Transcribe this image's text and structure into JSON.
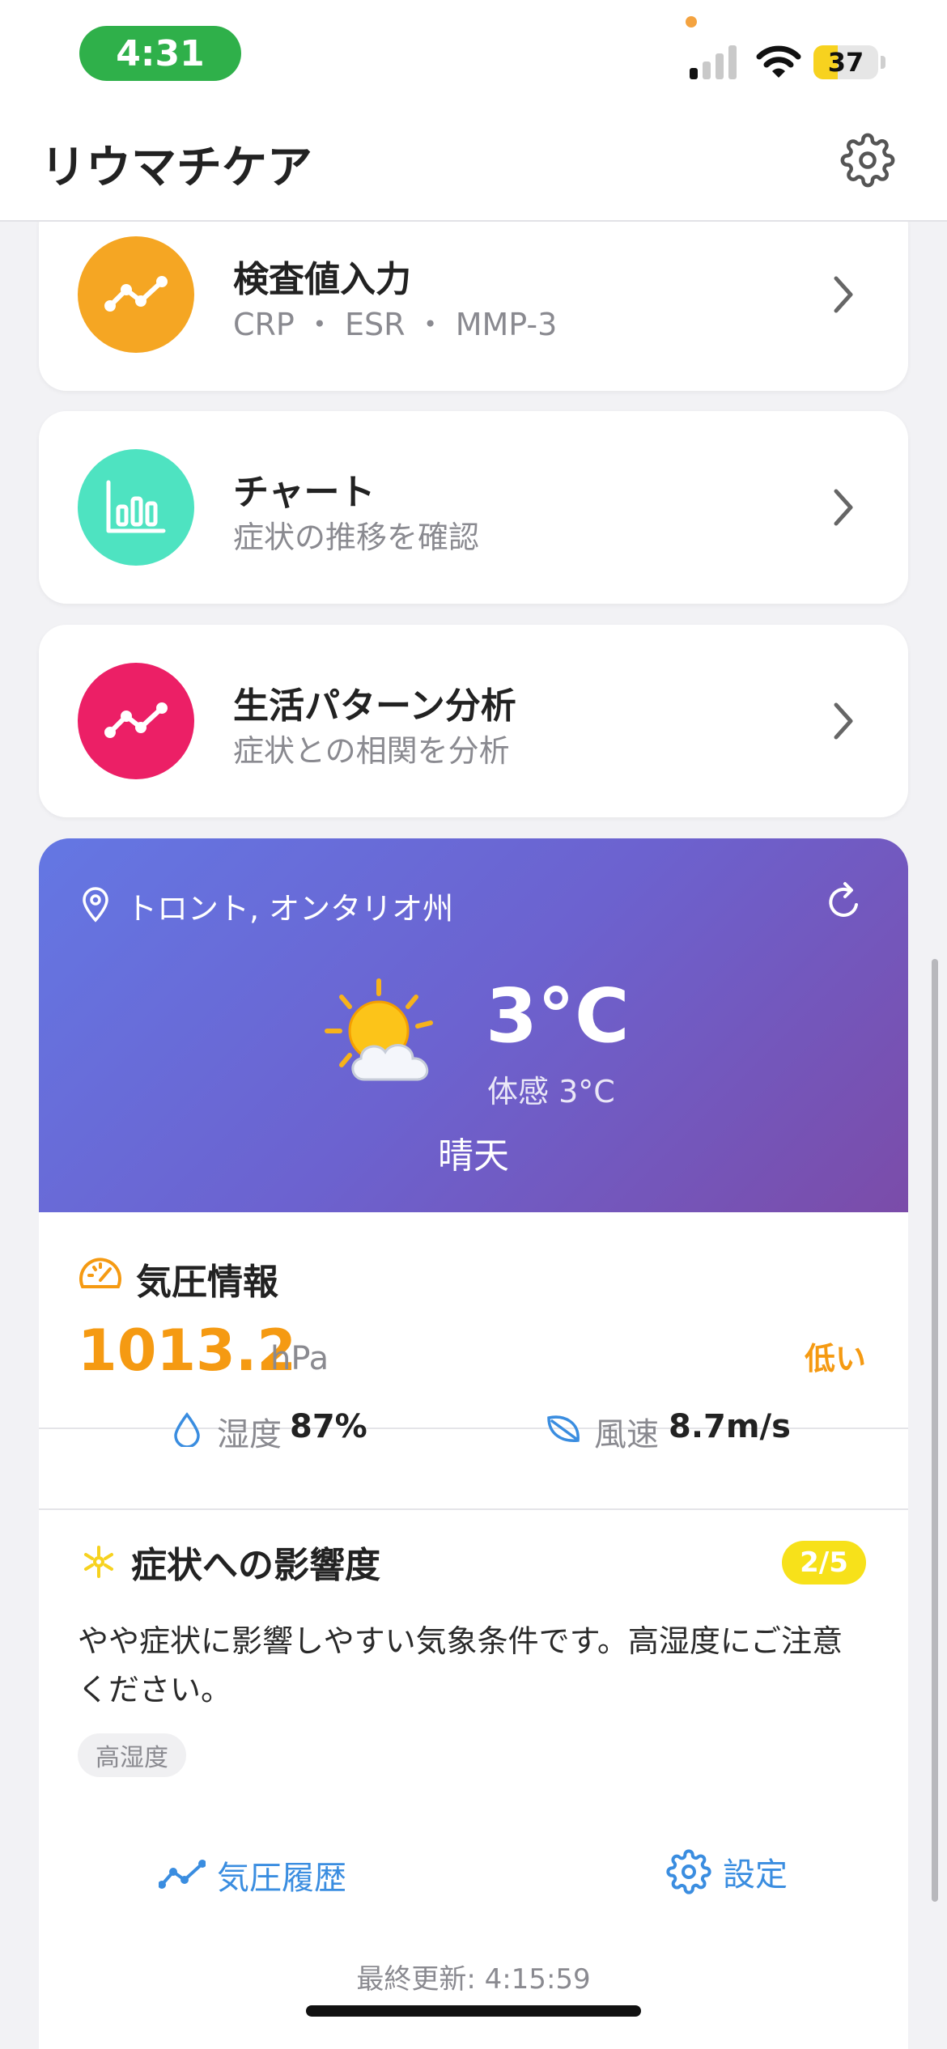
{
  "status_bar": {
    "time": "4:31",
    "battery": "37"
  },
  "header": {
    "title": "リウマチケア"
  },
  "menu": [
    {
      "title": "検査値入力",
      "subtitle": "CRP ・ ESR ・ MMP-3",
      "color": "#f5a623",
      "icon": "trend-line-icon"
    },
    {
      "title": "チャート",
      "subtitle": "症状の推移を確認",
      "color": "#4ee3c1",
      "icon": "bar-chart-icon"
    },
    {
      "title": "生活パターン分析",
      "subtitle": "症状との相関を分析",
      "color": "#ec1f66",
      "icon": "trend-line-icon"
    }
  ],
  "weather": {
    "location": "トロント, オンタリオ州",
    "temperature": "3°C",
    "feels_like": "体感 3°C",
    "condition": "晴天",
    "icon": "sun-behind-cloud-icon"
  },
  "pressure": {
    "title": "気圧情報",
    "value": "1013.2",
    "unit": "hPa",
    "status": "低い",
    "accent_color": "#f59a12"
  },
  "conditions": {
    "humidity_label": "湿度",
    "humidity_value": "87%",
    "wind_label": "風速",
    "wind_value": "8.7m/s"
  },
  "impact": {
    "title": "症状への影響度",
    "badge": "2/5",
    "description": "やや症状に影響しやすい気象条件です。高湿度にご注意ください。",
    "tag": "高湿度"
  },
  "actions": {
    "history": "気圧履歴",
    "settings": "設定"
  },
  "footer": {
    "last_updated": "最終更新: 4:15:59"
  }
}
